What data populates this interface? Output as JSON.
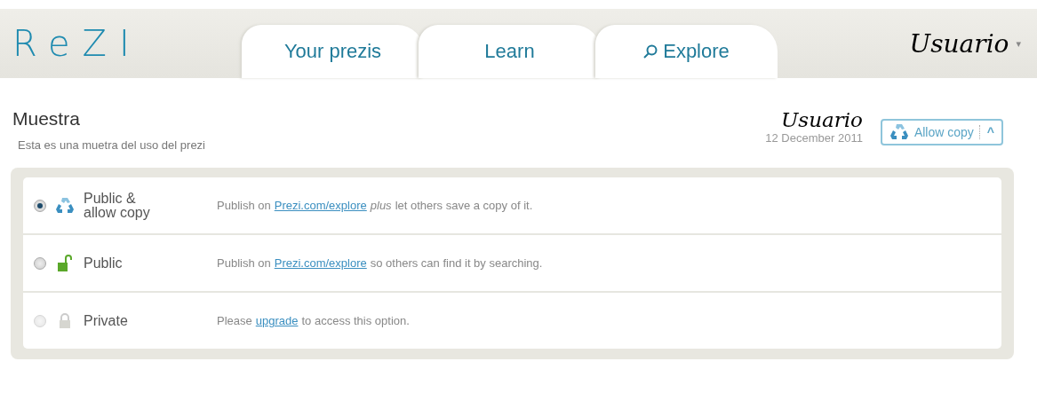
{
  "header": {
    "logo": "ReZI",
    "tabs": [
      {
        "label": "Your prezis",
        "selected": false,
        "kind": "plain"
      },
      {
        "label": "Learn",
        "selected": false,
        "kind": "plain"
      },
      {
        "label": "Explore",
        "selected": false,
        "kind": "search"
      }
    ],
    "user": "Usuario",
    "user_caret": "▾"
  },
  "prezi": {
    "title": "Muestra",
    "description": "Esta es una muetra del uso del prezi",
    "author": "Usuario",
    "date": "12 December 2011",
    "button": "Allow copy",
    "button_caret": "^"
  },
  "options": [
    {
      "label": "Public & allow copy",
      "kind": "recycle",
      "selected": true,
      "disabled": false,
      "description": [
        {
          "kind": "text",
          "text": "Publish on"
        },
        {
          "kind": "link",
          "text": "Prezi.com/explore"
        },
        {
          "kind": "em",
          "text": "plus"
        },
        {
          "kind": "text",
          "text": "let others save a copy of it."
        }
      ]
    },
    {
      "label": "Public",
      "kind": "lock-open",
      "selected": false,
      "disabled": false,
      "description": [
        {
          "kind": "text",
          "text": "Publish on"
        },
        {
          "kind": "link",
          "text": "Prezi.com/explore"
        },
        {
          "kind": "text",
          "text": "so others can find it by searching."
        }
      ]
    },
    {
      "label": "Private",
      "kind": "lock",
      "selected": false,
      "disabled": true,
      "description": [
        {
          "kind": "text",
          "text": "Please"
        },
        {
          "kind": "link",
          "text": "upgrade"
        },
        {
          "kind": "text",
          "text": "to access this option."
        }
      ]
    }
  ]
}
